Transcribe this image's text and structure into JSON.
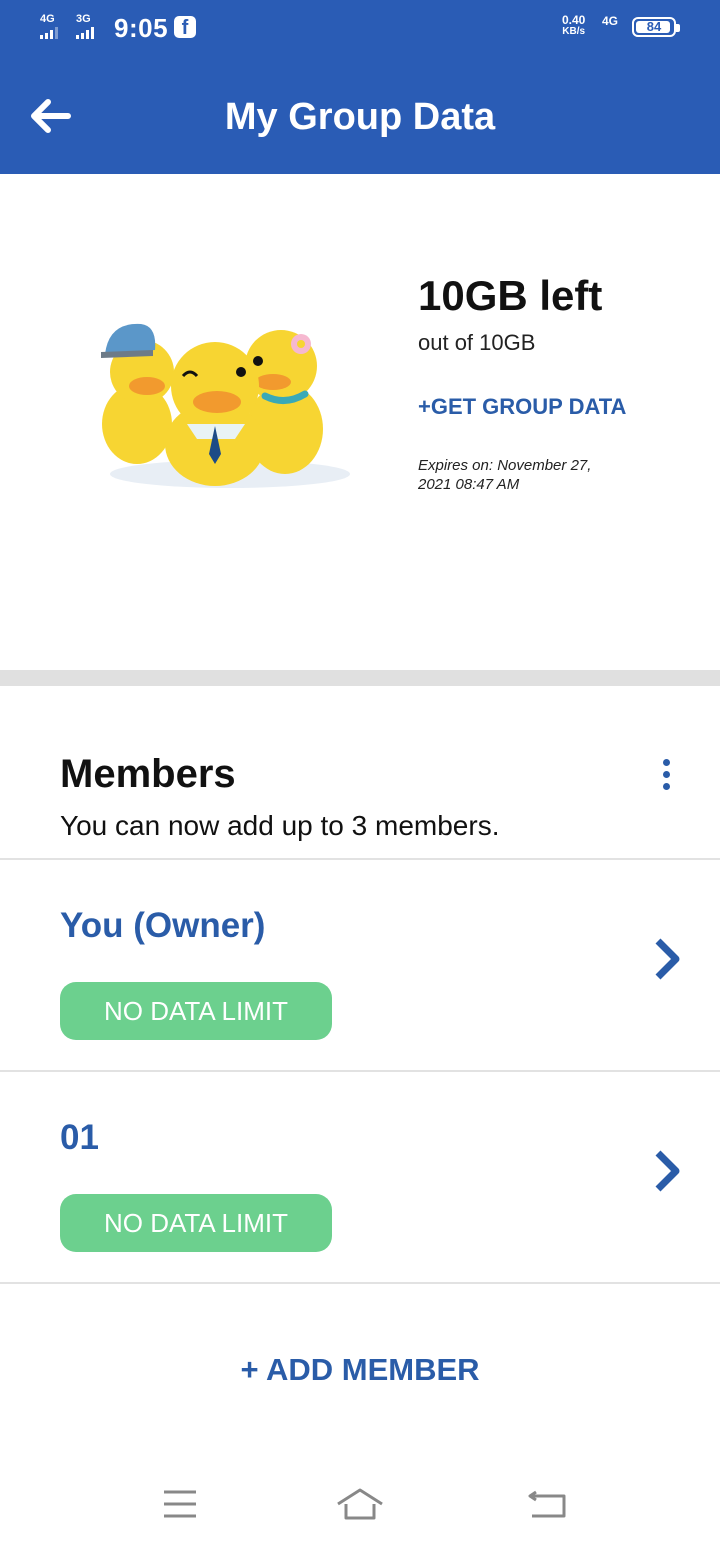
{
  "status_bar": {
    "net1": "4G",
    "net2": "3G",
    "time": "9:05",
    "app_badge": "f",
    "speed_value": "0.40",
    "speed_unit": "KB/s",
    "net3": "4G",
    "battery": "84"
  },
  "app_bar": {
    "title": "My Group Data",
    "back_icon": "back-arrow-icon"
  },
  "data": {
    "amount": "10GB left",
    "out_of": "out of 10GB",
    "get_data": "+GET GROUP DATA",
    "expires": "Expires on: November 27, 2021 08:47 AM",
    "illustration": "ducks-illustration"
  },
  "members": {
    "title": "Members",
    "subtitle": "You can now add up to 3 members.",
    "items": [
      {
        "name": "You (Owner)",
        "badge": "NO DATA LIMIT"
      },
      {
        "name": "01",
        "badge": "NO DATA LIMIT"
      }
    ],
    "add_label": "+ ADD MEMBER"
  },
  "colors": {
    "primary": "#2a5cb5",
    "link": "#2a5ca8",
    "badge": "#6cd08e",
    "divider": "#e0e0e0"
  },
  "nav": {
    "icons": [
      "menu-icon",
      "home-icon",
      "back-icon"
    ]
  }
}
